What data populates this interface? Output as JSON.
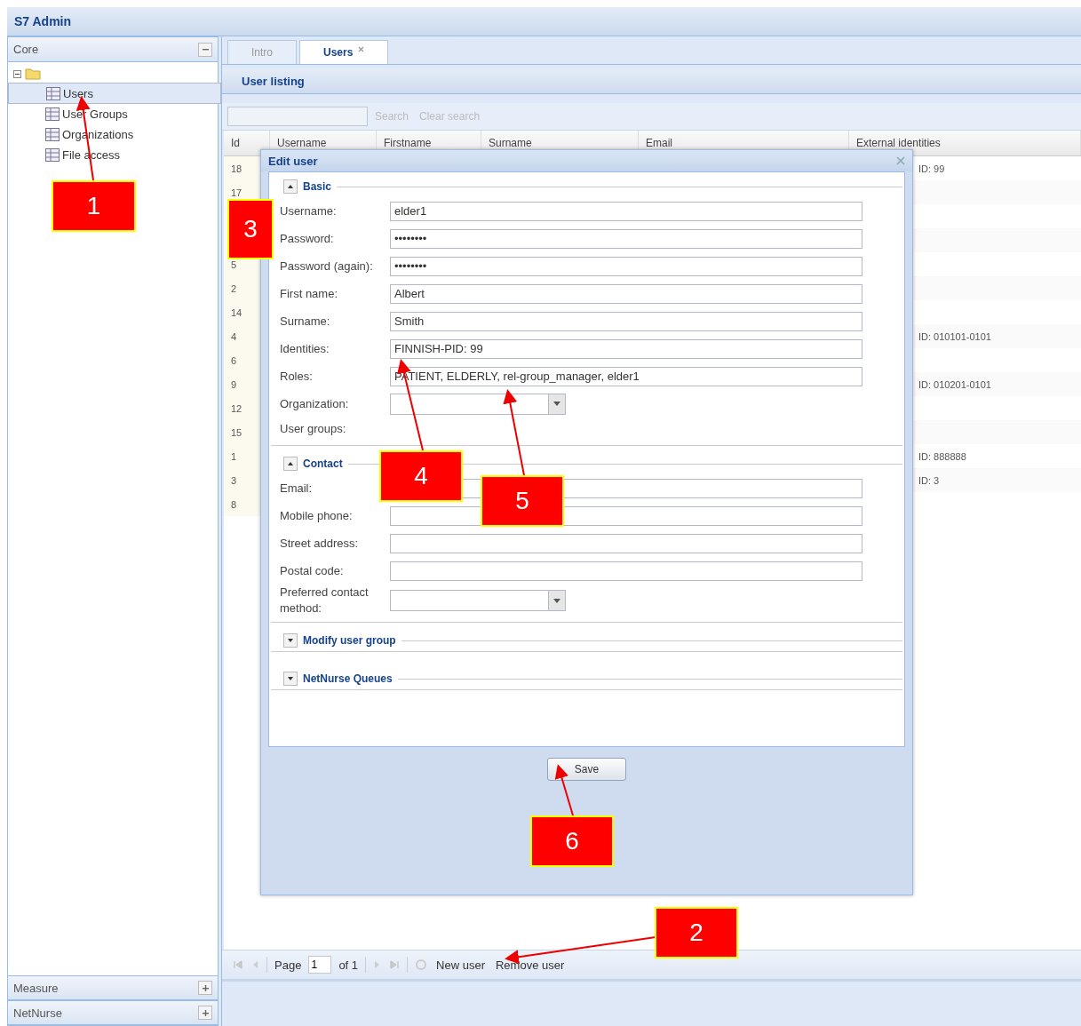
{
  "window": {
    "title": "S7 Admin"
  },
  "sidebar": {
    "panels": [
      {
        "title": "Core",
        "expanded": true
      },
      {
        "title": "Measure",
        "expanded": false
      },
      {
        "title": "NetNurse",
        "expanded": false
      }
    ],
    "tree": {
      "expanded": true,
      "children": [
        {
          "label": "Users",
          "selected": true
        },
        {
          "label": "User Groups",
          "selected": false
        },
        {
          "label": "Organizations",
          "selected": false
        },
        {
          "label": "File access",
          "selected": false
        }
      ]
    }
  },
  "tabs": [
    {
      "label": "Intro",
      "selected": false,
      "closable": false
    },
    {
      "label": "Users",
      "selected": true,
      "closable": true
    }
  ],
  "panel_title": "User listing",
  "toolbar": {
    "buttons": [
      {
        "label": "Search",
        "disabled": true
      },
      {
        "label": "Clear search",
        "disabled": true
      }
    ]
  },
  "grid": {
    "columns": [
      "Id",
      "Username",
      "Firstname",
      "Surname",
      "Email",
      "External identities"
    ],
    "rows": [
      {
        "id": "18",
        "external_identities": "ID: 99"
      },
      {
        "id": "17"
      },
      {},
      {},
      {
        "id": "5"
      },
      {
        "id": "2"
      },
      {
        "id": "14"
      },
      {
        "id": "4",
        "external_identities": "ID: 010101-0101"
      },
      {
        "id": "6"
      },
      {
        "id": "9",
        "external_identities": "ID: 010201-0101"
      },
      {
        "id": "12"
      },
      {
        "id": "15"
      },
      {
        "id": "1",
        "external_identities": "ID: 888888"
      },
      {
        "id": "3",
        "external_identities": "ID: 3"
      },
      {
        "id": "8"
      }
    ]
  },
  "paging": {
    "page_label": "Page",
    "page": "1",
    "of": "of 1",
    "actions": [
      "New user",
      "Remove user"
    ]
  },
  "dialog": {
    "title": "Edit user",
    "sections": [
      {
        "title": "Basic",
        "expanded": true,
        "fields": [
          {
            "label": "Username:",
            "kind": "text",
            "value": "elder1"
          },
          {
            "label": "Password:",
            "kind": "text",
            "value": "••••••••"
          },
          {
            "label": "Password (again):",
            "kind": "text",
            "value": "••••••••"
          },
          {
            "label": "First name:",
            "kind": "text",
            "value": "Albert"
          },
          {
            "label": "Surname:",
            "kind": "text",
            "value": "Smith"
          },
          {
            "label": "Identities:",
            "kind": "text",
            "value": "FINNISH-PID: 99"
          },
          {
            "label": "Roles:",
            "kind": "text",
            "value": "PATIENT, ELDERLY, rel-group_manager, elder1"
          },
          {
            "label": "Organization:",
            "kind": "select"
          },
          {
            "label": "User groups:",
            "kind": "label"
          }
        ]
      },
      {
        "title": "Contact",
        "expanded": true,
        "fields": [
          {
            "label": "Email:",
            "kind": "text"
          },
          {
            "label": "Mobile phone:",
            "kind": "text"
          },
          {
            "label": "Street address:",
            "kind": "text"
          },
          {
            "label": "Postal code:",
            "kind": "text"
          },
          {
            "label": "Preferred contact method:",
            "kind": "select"
          }
        ]
      },
      {
        "title": "Modify user group",
        "expanded": false
      },
      {
        "title": "NetNurse Queues",
        "expanded": false
      }
    ],
    "save": "Save"
  },
  "callouts": [
    {
      "number": "1"
    },
    {
      "number": "2"
    },
    {
      "number": "3"
    },
    {
      "number": "4"
    },
    {
      "number": "5"
    },
    {
      "number": "6"
    }
  ]
}
